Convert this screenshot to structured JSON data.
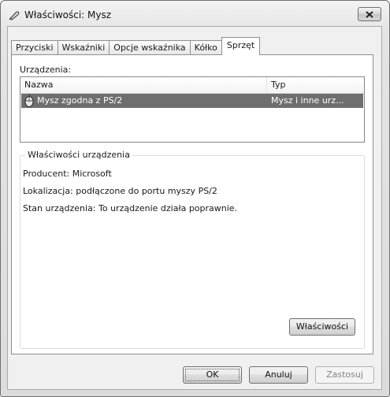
{
  "window": {
    "title": "Właściwości: Mysz"
  },
  "icons": {
    "title_icon": "mouse-pointer-icon",
    "close_icon": "close-icon",
    "device_icon": "mouse-icon"
  },
  "tabs": [
    {
      "label": "Przyciski"
    },
    {
      "label": "Wskaźniki"
    },
    {
      "label": "Opcje wskaźnika"
    },
    {
      "label": "Kółko"
    },
    {
      "label": "Sprzęt",
      "active": true
    }
  ],
  "devices": {
    "label": "Urządzenia:",
    "columns": {
      "name": "Nazwa",
      "type": "Typ"
    },
    "rows": [
      {
        "name": "Mysz zgodna z PS/2",
        "type": "Mysz i inne urz...",
        "selected": true
      }
    ]
  },
  "device_properties": {
    "title": "Właściwości urządzenia",
    "manufacturer": "Producent: Microsoft",
    "location": "Lokalizacja: podłączone do portu myszy PS/2",
    "status": "Stan urządzenia: To urządzenie działa poprawnie.",
    "properties_button": "Właściwości"
  },
  "footer": {
    "ok": "OK",
    "cancel": "Anuluj",
    "apply": "Zastosuj"
  },
  "colors": {
    "selection": "#6e6e6e",
    "disabled_text": "#838383"
  }
}
